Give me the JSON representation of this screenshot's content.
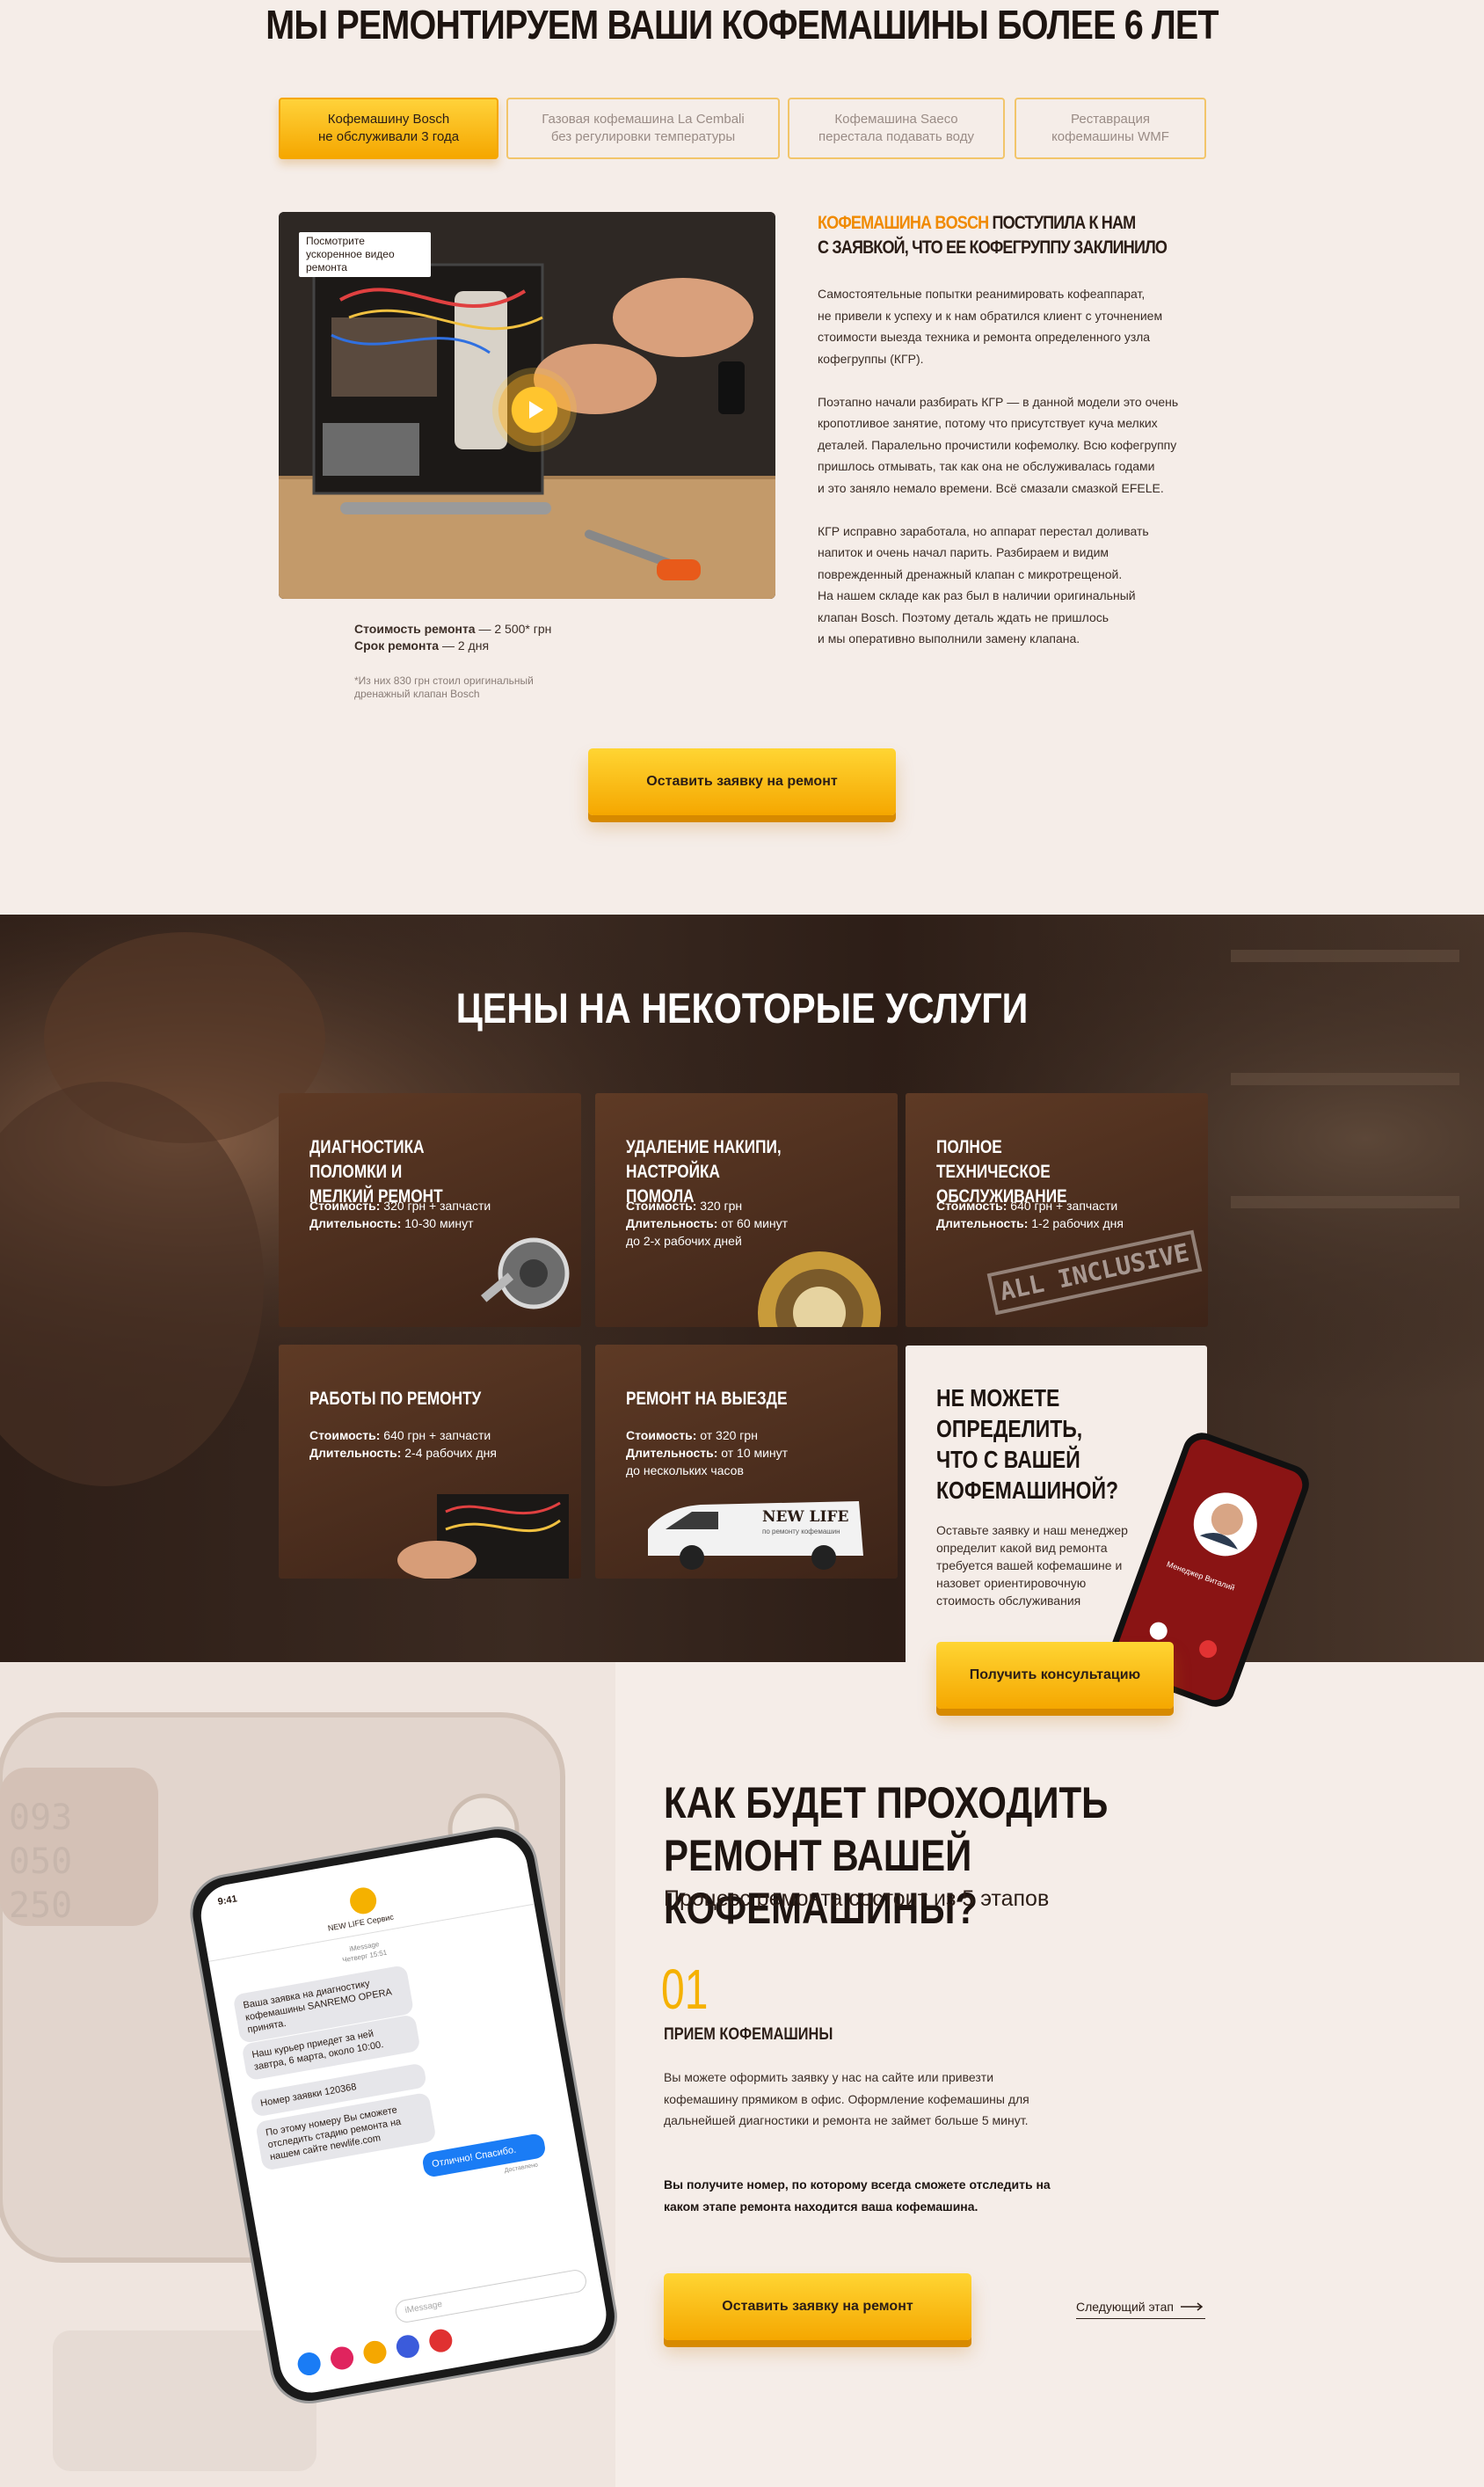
{
  "section1": {
    "title": "МЫ РЕМОНТИРУЕМ ВАШИ КОФЕМАШИНЫ БОЛЕЕ 6 ЛЕТ",
    "tabs": [
      {
        "line1": "Кофемашину Bosch",
        "line2": "не обслуживали 3 года"
      },
      {
        "line1": "Газовая кофемашина La Cembali",
        "line2": "без регулировки температуры"
      },
      {
        "line1": "Кофемашина Saeco",
        "line2": "перестала подавать воду"
      },
      {
        "line1": "Реставрация",
        "line2": "кофемашины WMF"
      }
    ],
    "video_label": "Посмотрите ускоренное видео ремонта",
    "cost_label": "Стоимость ремонта",
    "cost_value": " — 2 500* грн",
    "term_label": "Срок ремонта",
    "term_value": " — 2 дня",
    "footnote_1": "*Из них 830 грн  стоил оригинальный",
    "footnote_2": "дренажный клапан Bosch",
    "case_title_accent": "КОФЕМАШИНА BOSCH",
    "case_title_rest1": " ПОСТУПИЛА К НАМ",
    "case_title_rest2": "С ЗАЯВКОЙ, ЧТО ЕЕ КОФЕГРУППУ ЗАКЛИНИЛО",
    "case_text": "Самостоятельные попытки реанимировать кофеаппарат,\nне привели к успеху и к нам обратился клиент с уточнением\nстоимости выезда техника и ремонта определенного узла\nкофегруппы (КГР).\n\nПоэтапно начали разбирать КГР — в данной модели это очень\nкропотливое занятие, потому что присутствует куча мелких\nдеталей. Паралельно прочистили кофемолку. Всю кофегруппу\nпришлось отмывать, так как она не обслуживалась годами\nи это заняло немало времени. Всё смазали смазкой EFELE.\n\nКГР исправно заработала, но аппарат перестал доливать\nнапиток и очень начал парить. Разбираем и видим\nповрежденный дренажный клапан с микротрещеной.\nНа нашем складе как раз был в наличии оригинальный\nклапан Bosch. Поэтому деталь ждать не пришлось\nи мы оперативно выполнили замену клапана.",
    "cta": "Оставить заявку на ремонт"
  },
  "section2": {
    "title": "ЦЕНЫ НА НЕКОТОРЫЕ УСЛУГИ",
    "cost_word": "Стоимость:",
    "dur_word": "Длительность:",
    "cards": [
      {
        "title": "ДИАГНОСТИКА ПОЛОМКИ И МЕЛКИЙ РЕМОНТ",
        "cost": " 320 грн + запчасти",
        "dur": " 10-30 минут",
        "extra": ""
      },
      {
        "title": "УДАЛЕНИЕ НАКИПИ, НАСТРОЙКА ПОМОЛА",
        "cost": " 320 грн",
        "dur": " от 60 минут",
        "extra": "до 2-х рабочих дней"
      },
      {
        "title": "ПОЛНОЕ ТЕХНИЧЕСКОЕ ОБСЛУЖИВАНИЕ",
        "cost": " 640 грн + запчасти",
        "dur": " 1-2 рабочих дня",
        "extra": ""
      },
      {
        "title": "РАБОТЫ ПО РЕМОНТУ",
        "cost": " 640 грн + запчасти",
        "dur": " 2-4 рабочих дня",
        "extra": ""
      },
      {
        "title": "РЕМОНТ НА ВЫЕЗДЕ",
        "cost": " от 320 грн",
        "dur": " от 10 минут",
        "extra": "до нескольких часов"
      }
    ],
    "stamp": "ALL INCLUSIVE",
    "van_brand": "NEW LIFE",
    "van_sub": "по ремонту кофемашин",
    "cta_title": "НЕ МОЖЕТЕ ОПРЕДЕЛИТЬ, ЧТО С ВАШЕЙ КОФЕМАШИНОЙ?",
    "cta_text": "Оставьте заявку и наш менеджер определит какой вид ремонта требуется вашей кофемашине и назовет ориентировочную стоимость обслуживания",
    "cta_button": "Получить консультацию",
    "caller_name": "Менеджер Виталий"
  },
  "section3": {
    "title": "КАК БУДЕТ ПРОХОДИТЬ РЕМОНТ ВАШЕЙ КОФЕМАШИНЫ?",
    "subtitle": "Процесс ремонта состоит из 5 этапов",
    "step_num": "01",
    "step_title": "ПРИЕМ КОФЕМАШИНЫ",
    "step_text": "Вы можете оформить заявку у нас на сайте или привезти кофемашину прямиком в офис. Оформление кофемашины для дальнейшей диагностики и ремонта не займет больше 5 минут.",
    "step_bold": "Вы получите номер, по которому всегда сможете отследить на каком этапе ремонта находится ваша кофемашина.",
    "cta": "Оставить заявку на ремонт",
    "next": "Следующий этап",
    "phone": {
      "time": "9:41",
      "contact": "NEW LIFE Сервис",
      "meta1": "iMessage",
      "meta2": "Четверг 15:51",
      "msg1": "Ваша заявка на диагностику кофемашины SANREMO OPERA принята.",
      "msg2": "Наш курьер приедет за ней завтра, 6 марта, около 10:00.",
      "msg3": "Номер заявки 120368",
      "msg4": "По этому номеру Вы сможете отследить стадию ремонта на нашем сайте newlife.com",
      "reply": "Отлично! Спасибо.",
      "delivered": "Доставлено",
      "input": "iMessage"
    }
  },
  "colors": {
    "accent": "#f5a700",
    "orange_text": "#f08a00",
    "bg": "#f5ede8",
    "dark": "#2d1e17"
  }
}
